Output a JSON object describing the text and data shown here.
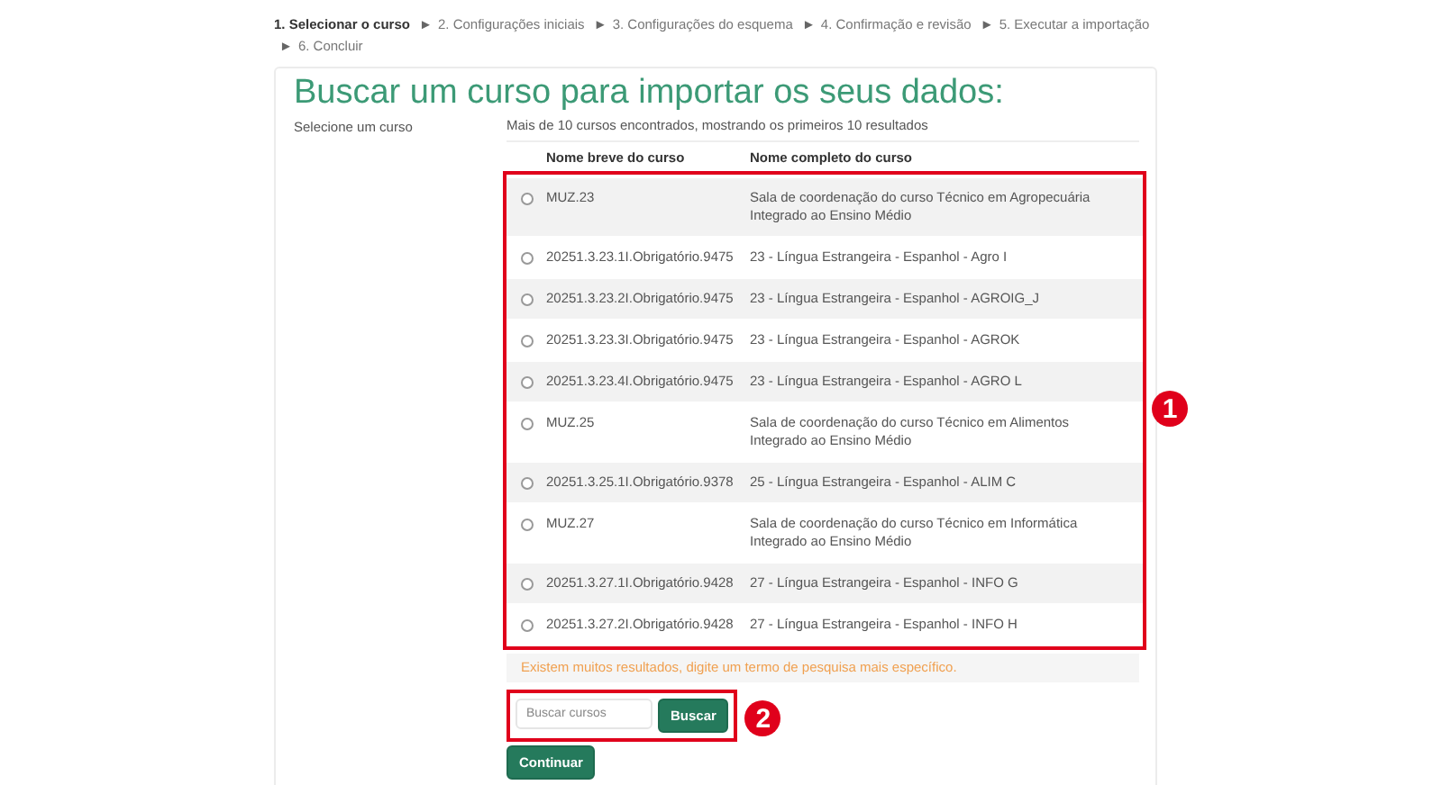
{
  "steps": [
    {
      "label": "1. Selecionar o curso",
      "selected": true
    },
    {
      "label": "2. Configurações iniciais",
      "selected": false
    },
    {
      "label": "3. Configurações do esquema",
      "selected": false
    },
    {
      "label": "4. Confirmação e revisão",
      "selected": false
    },
    {
      "label": "5. Executar a importação",
      "selected": false
    },
    {
      "label": "6. Concluir",
      "selected": false
    }
  ],
  "step_separator": "►",
  "title": "Buscar um curso para importar os seus dados:",
  "field_label": "Selecione um curso",
  "summary": "Mais de 10 cursos encontrados, mostrando os primeiros 10 resultados",
  "columns": [
    "Nome breve do curso",
    "Nome completo do curso"
  ],
  "rows": [
    {
      "short": "MUZ.23",
      "full": "Sala de coordenação do curso Técnico em Agropecuária Integrado ao Ensino Médio",
      "selected": false
    },
    {
      "short": "20251.3.23.1I.Obrigatório.9475",
      "full": "23 - Língua Estrangeira - Espanhol - Agro I",
      "selected": false
    },
    {
      "short": "20251.3.23.2I.Obrigatório.9475",
      "full": "23 - Língua Estrangeira - Espanhol - AGROIG_J",
      "selected": false
    },
    {
      "short": "20251.3.23.3I.Obrigatório.9475",
      "full": "23 - Língua Estrangeira - Espanhol - AGROK",
      "selected": false
    },
    {
      "short": "20251.3.23.4I.Obrigatório.9475",
      "full": "23 - Língua Estrangeira - Espanhol - AGRO L",
      "selected": false
    },
    {
      "short": "MUZ.25",
      "full": "Sala de coordenação do curso Técnico em Alimentos Integrado ao Ensino Médio",
      "selected": false
    },
    {
      "short": "20251.3.25.1I.Obrigatório.9378",
      "full": "25 - Língua Estrangeira - Espanhol - ALIM C",
      "selected": false
    },
    {
      "short": "MUZ.27",
      "full": "Sala de coordenação do curso Técnico em Informática Integrado ao Ensino Médio",
      "selected": false
    },
    {
      "short": "20251.3.27.1I.Obrigatório.9428",
      "full": "27 - Língua Estrangeira - Espanhol - INFO G",
      "selected": false
    },
    {
      "short": "20251.3.27.2I.Obrigatório.9428",
      "full": "27 - Língua Estrangeira - Espanhol - INFO H",
      "selected": false
    }
  ],
  "warning": "Existem muitos resultados, digite um termo de pesquisa mais específico.",
  "search": {
    "placeholder": "Buscar cursos",
    "button": "Buscar"
  },
  "continue_button": "Continuar",
  "callouts": [
    "1",
    "2"
  ]
}
